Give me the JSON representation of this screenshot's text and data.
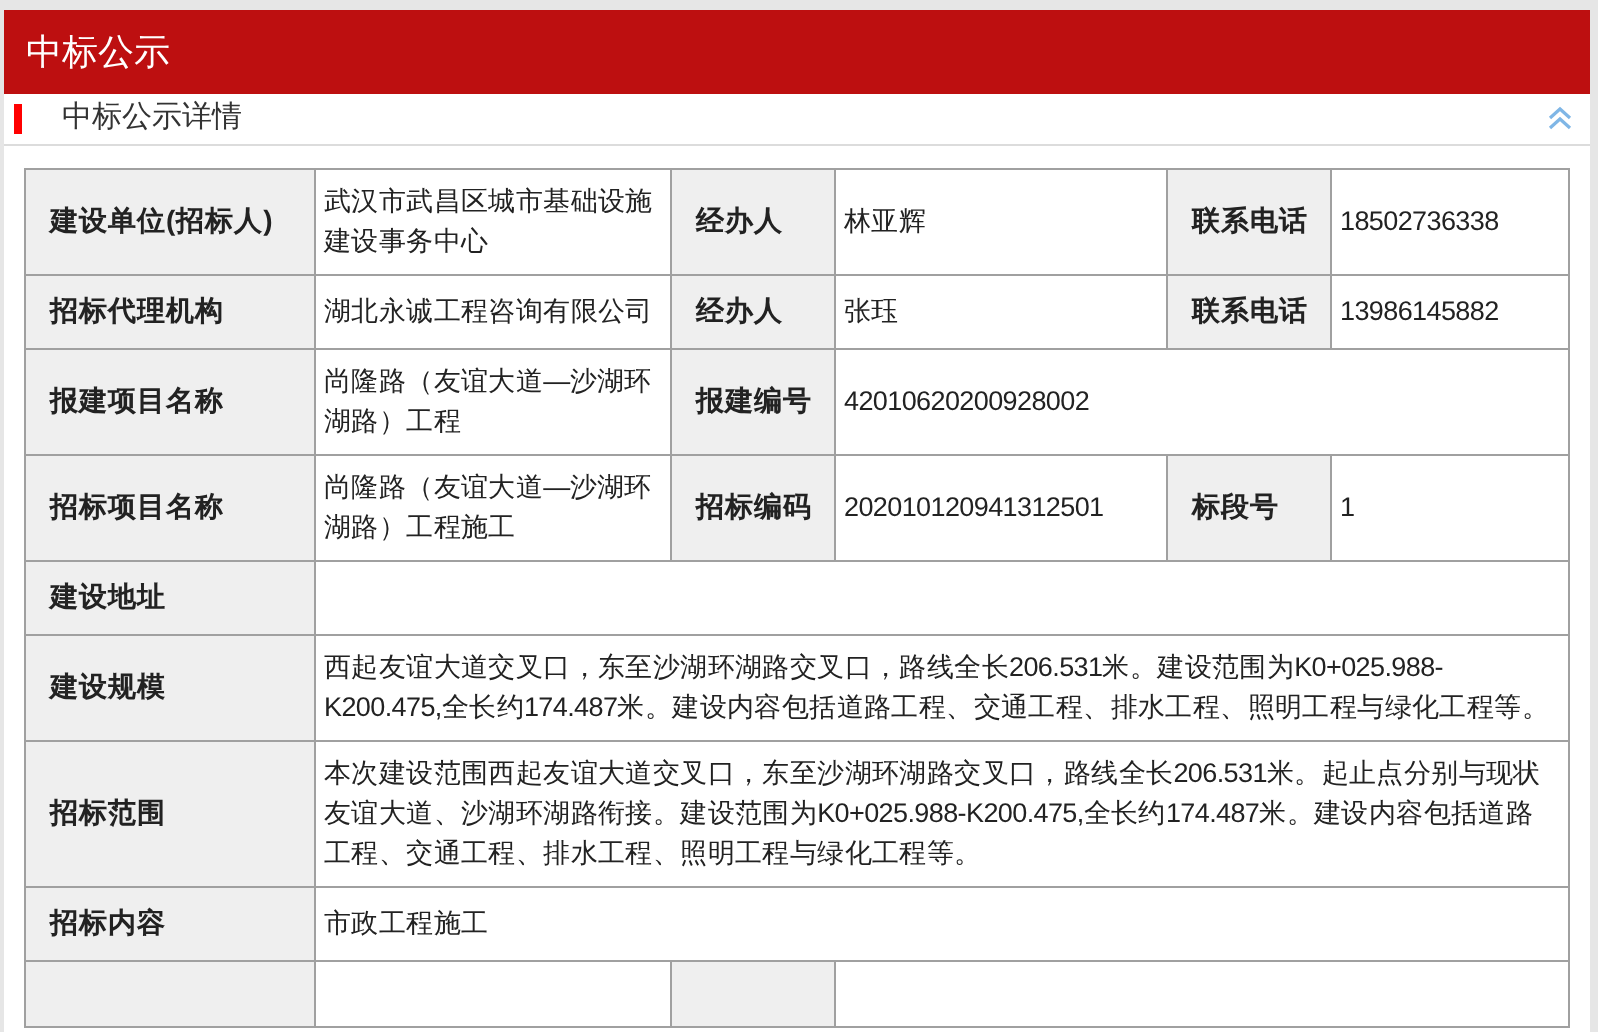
{
  "header": {
    "title": "中标公示"
  },
  "section": {
    "title": "中标公示详情"
  },
  "table": {
    "rows": [
      [
        {
          "kind": "label",
          "text": "建设单位(招标人)"
        },
        {
          "kind": "value",
          "text": "武汉市武昌区城市基础设施建设事务中心"
        },
        {
          "kind": "label",
          "text": "经办人"
        },
        {
          "kind": "value",
          "text": "林亚辉"
        },
        {
          "kind": "label",
          "text": "联系电话"
        },
        {
          "kind": "value",
          "text": "18502736338"
        }
      ],
      [
        {
          "kind": "label",
          "text": "招标代理机构"
        },
        {
          "kind": "value",
          "text": "湖北永诚工程咨询有限公司"
        },
        {
          "kind": "label",
          "text": "经办人"
        },
        {
          "kind": "value",
          "text": "张珏"
        },
        {
          "kind": "label",
          "text": "联系电话"
        },
        {
          "kind": "value",
          "text": "13986145882"
        }
      ],
      [
        {
          "kind": "label",
          "text": "报建项目名称"
        },
        {
          "kind": "value",
          "text": "尚隆路（友谊大道—沙湖环湖路）工程"
        },
        {
          "kind": "label",
          "text": "报建编号"
        },
        {
          "kind": "value",
          "text": "42010620200928002",
          "colspan": 3
        }
      ],
      [
        {
          "kind": "label",
          "text": "招标项目名称"
        },
        {
          "kind": "value",
          "text": "尚隆路（友谊大道—沙湖环湖路）工程施工"
        },
        {
          "kind": "label",
          "text": "招标编码"
        },
        {
          "kind": "value",
          "text": "202010120941312501"
        },
        {
          "kind": "label",
          "text": "标段号"
        },
        {
          "kind": "value",
          "text": "1"
        }
      ],
      [
        {
          "kind": "label",
          "text": "建设地址"
        },
        {
          "kind": "value",
          "colspan": 5
        }
      ],
      [
        {
          "kind": "label",
          "text": "建设规模"
        },
        {
          "kind": "value",
          "text": "西起友谊大道交叉口，东至沙湖环湖路交叉口，路线全长206.531米。建设范围为K0+025.988-K200.475,全长约174.487米。建设内容包括道路工程、交通工程、排水工程、照明工程与绿化工程等。",
          "colspan": 5
        }
      ],
      [
        {
          "kind": "label",
          "text": "招标范围"
        },
        {
          "kind": "value",
          "text": "本次建设范围西起友谊大道交叉口，东至沙湖环湖路交叉口，路线全长206.531米。起止点分别与现状友谊大道、沙湖环湖路衔接。建设范围为K0+025.988-K200.475,全长约174.487米。建设内容包括道路工程、交通工程、排水工程、照明工程与绿化工程等。",
          "colspan": 5
        }
      ],
      [
        {
          "kind": "label",
          "text": "招标内容"
        },
        {
          "kind": "value",
          "text": "市政工程施工",
          "colspan": 5
        }
      ]
    ]
  }
}
